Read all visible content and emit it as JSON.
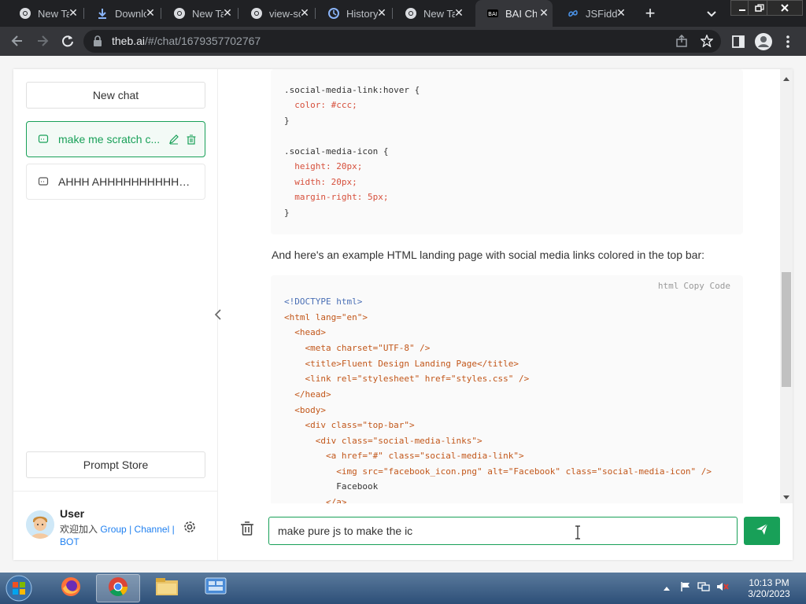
{
  "browser": {
    "tabs": [
      {
        "title": "New Tab",
        "icon": "chrome-icon"
      },
      {
        "title": "Downloads",
        "icon": "download-icon"
      },
      {
        "title": "New Tab",
        "icon": "chrome-icon"
      },
      {
        "title": "view-source",
        "icon": "chrome-icon"
      },
      {
        "title": "History",
        "icon": "history-icon"
      },
      {
        "title": "New Tab",
        "icon": "chrome-icon"
      },
      {
        "title": "BAI Chat",
        "icon": "bai-icon"
      },
      {
        "title": "JSFiddle",
        "icon": "jsfiddle-icon"
      }
    ],
    "active_tab": 6,
    "url_host": "theb.ai",
    "url_path": "/#/chat/1679357702767"
  },
  "sidebar": {
    "new_chat_label": "New chat",
    "chats": [
      {
        "title": "make me scratch c...",
        "active": true
      },
      {
        "title": "AHHH AHHHHHHHHHHH...",
        "active": false
      }
    ],
    "prompt_store_label": "Prompt Store",
    "user": {
      "name": "User",
      "join_text": "欢迎加入",
      "group_label": "Group",
      "sep1": "|",
      "channel_label": "Channel",
      "sep2": "|",
      "bot_label": "BOT"
    }
  },
  "chat": {
    "prose": "And here's an example HTML landing page with social media links colored in the top bar:",
    "code_lang": "html",
    "copy_label": "Copy Code",
    "css_lines": [
      ".social-media-link:hover {",
      "  color: #ccc;",
      "}",
      "",
      ".social-media-icon {",
      "  height: 20px;",
      "  width: 20px;",
      "  margin-right: 5px;",
      "}"
    ],
    "html_lines": [
      "<!DOCTYPE html>",
      "<html lang=\"en\">",
      "  <head>",
      "    <meta charset=\"UTF-8\" />",
      "    <title>Fluent Design Landing Page</title>",
      "    <link rel=\"stylesheet\" href=\"styles.css\" />",
      "  </head>",
      "  <body>",
      "    <div class=\"top-bar\">",
      "      <div class=\"social-media-links\">",
      "        <a href=\"#\" class=\"social-media-link\">",
      "          <img src=\"facebook_icon.png\" alt=\"Facebook\" class=\"social-media-icon\" />",
      "          Facebook",
      "        </a>"
    ]
  },
  "input": {
    "value": "make pure js to make the ic"
  },
  "taskbar": {
    "time": "10:13 PM",
    "date": "3/20/2023"
  },
  "colors": {
    "accent": "#18a058",
    "link": "#2080f0",
    "chrome_dark": "#202124",
    "chrome_toolbar": "#35363a"
  }
}
